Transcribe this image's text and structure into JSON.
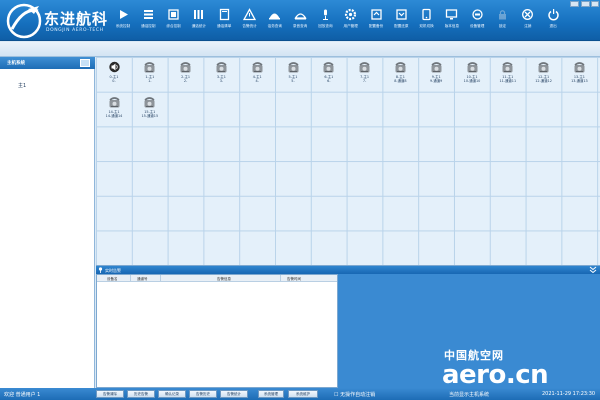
{
  "brand": {
    "name": "东进航科",
    "sub": "DONGJIN AERO-TECH"
  },
  "toolbar": [
    {
      "label": "系统控制",
      "icon": "play-icon"
    },
    {
      "label": "通话控制",
      "icon": "list-icon"
    },
    {
      "label": "综合控制",
      "icon": "panel-icon"
    },
    {
      "label": "通话统计",
      "icon": "tally-icon"
    },
    {
      "label": "通话清单",
      "icon": "book-icon"
    },
    {
      "label": "告警统计",
      "icon": "warning-icon"
    },
    {
      "label": "话务查询",
      "icon": "dome-icon"
    },
    {
      "label": "录音查询",
      "icon": "dome2-icon"
    },
    {
      "label": "回放查询",
      "icon": "mic-icon"
    },
    {
      "label": "用户管理",
      "icon": "gear-icon"
    },
    {
      "label": "配置备份",
      "icon": "backup-icon"
    },
    {
      "label": "配置还原",
      "icon": "restore-icon"
    },
    {
      "label": "双机切换",
      "icon": "switch-icon"
    },
    {
      "label": "版本信息",
      "icon": "monitor-icon"
    },
    {
      "label": "设备管理",
      "icon": "device-icon"
    },
    {
      "label": "锁定",
      "icon": "lock-icon"
    },
    {
      "label": "注销",
      "icon": "cancel-icon"
    },
    {
      "label": "退出",
      "icon": "power-icon"
    }
  ],
  "left_panel": {
    "title": "主机系统",
    "item": "主1"
  },
  "cells": [
    {
      "l1": "0-主1",
      "l2": "0-",
      "type": "speaker"
    },
    {
      "l1": "1-主1",
      "l2": "1-",
      "type": "phone"
    },
    {
      "l1": "2-主1",
      "l2": "2-",
      "type": "phone"
    },
    {
      "l1": "3-主1",
      "l2": "3-",
      "type": "phone"
    },
    {
      "l1": "4-主1",
      "l2": "4-",
      "type": "phone"
    },
    {
      "l1": "5-主1",
      "l2": "5-",
      "type": "phone"
    },
    {
      "l1": "6-主1",
      "l2": "6-",
      "type": "phone"
    },
    {
      "l1": "7-主1",
      "l2": "7-",
      "type": "phone"
    },
    {
      "l1": "8-主1",
      "l2": "8-通道8",
      "type": "phone"
    },
    {
      "l1": "9-主1",
      "l2": "9-通道9",
      "type": "phone"
    },
    {
      "l1": "10-主1",
      "l2": "10-通道10",
      "type": "phone"
    },
    {
      "l1": "11-主1",
      "l2": "11-通道11",
      "type": "phone"
    },
    {
      "l1": "12-主1",
      "l2": "12-通道12",
      "type": "phone"
    },
    {
      "l1": "13-主1",
      "l2": "13-通道13",
      "type": "phone"
    },
    {
      "l1": "14-主1",
      "l2": "14-通道14",
      "type": "phone"
    },
    {
      "l1": "15-主1",
      "l2": "15-通道15",
      "type": "phone"
    }
  ],
  "log": {
    "title": "实时告警",
    "columns": [
      "设备名",
      "通道号",
      "告警信息",
      "告警时间"
    ]
  },
  "status": {
    "user": "欢迎 普通用户 1",
    "buttons": [
      "告警清除",
      "历史告警",
      "确认记录",
      "告警历史",
      "告警统计",
      "系统管理",
      "系统维护"
    ],
    "checkbox": "无操作自动注销",
    "right_text": "当前显示主机系统",
    "time": "2021-11-29 17:23:30"
  },
  "watermark": {
    "cn": "中国航空网",
    "en": "aero.cn"
  },
  "colors": {
    "accent": "#156fbd",
    "grid": "#e4f0fa",
    "panel_blue": "#3a8ad2"
  }
}
